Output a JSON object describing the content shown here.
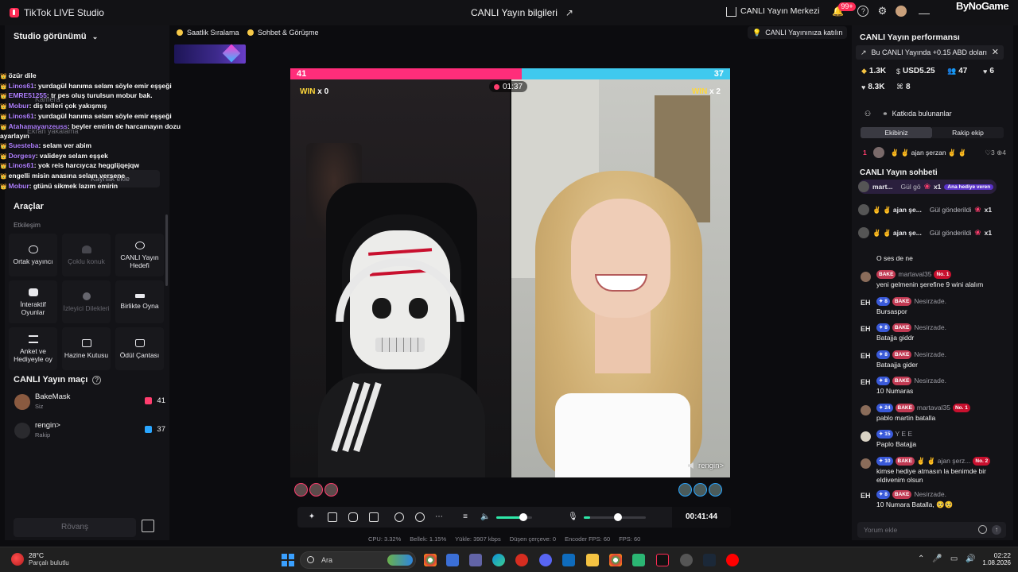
{
  "app": {
    "title": "TikTok LIVE Studio",
    "center_title": "CANLI Yayın bilgileri",
    "live_center": "CANLI Yayın Merkezi",
    "notifications": "99+",
    "watermark": "ByNoGame"
  },
  "left": {
    "studio_view": "Studio görünümü",
    "chat_overlay": [
      {
        "user": "",
        "text": "özür dile"
      },
      {
        "user": "Linos61",
        "text": ": yurdagül hanıma selam söyle emir eşşeği"
      },
      {
        "user": "EMRE51255",
        "text": ": tr pes oluş turulsun mobur bak."
      },
      {
        "user": "Mobur",
        "text": ": diş telleri çok yakışmış"
      },
      {
        "user": "Linos61",
        "text": ": yurdagül hanıma selam söyle emir eşşeği"
      },
      {
        "user": "Atahamayanzeuss",
        "text": ": beyler emirin de harcamayın dozu ayarlayın"
      },
      {
        "user": "Suesteba",
        "text": ": selam ver abim"
      },
      {
        "user": "Dorgesy",
        "text": ": valideye selam eşşek"
      },
      {
        "user": "Linos61",
        "text": ": yok reis harcıycaz hegglijqejqw"
      },
      {
        "user": "",
        "text": "engelli misin anasına selam versene"
      },
      {
        "user": "Mobur",
        "text": ": gtünü sikmek lazım emirin"
      }
    ],
    "ghost": {
      "camera": "Kamera",
      "screen_capture": "Ekran yakalama",
      "add_source": "Kaynak ekle"
    },
    "tools_title": "Araçlar",
    "tools_subtitle": "Etkileşim",
    "tools": [
      {
        "label": "Ortak yayıncı",
        "dim": false
      },
      {
        "label": "Çoklu konuk",
        "dim": true
      },
      {
        "label": "CANLI Yayın Hedefi",
        "dim": false
      },
      {
        "label": "İnteraktif Oyunlar",
        "dim": false
      },
      {
        "label": "İzleyici Dilekleri",
        "dim": true
      },
      {
        "label": "Birlikte Oyna",
        "dim": false
      },
      {
        "label": "Anket ve Hediyeyle oy",
        "dim": false
      },
      {
        "label": "Hazine Kutusu",
        "dim": false
      },
      {
        "label": "Ödül Çantası",
        "dim": false
      }
    ],
    "match_title": "CANLI Yayın maçı",
    "match": [
      {
        "name": "BakeMask",
        "sub": "Siz",
        "score": "41"
      },
      {
        "name": "rengin>",
        "sub": "Rakip",
        "score": "37"
      }
    ],
    "rematch": "Rövanş"
  },
  "top_pills": {
    "ranking": "Saatlik Sıralama",
    "chat_call": "Sohbet & Görüşme",
    "join": "CANLI Yayınınıza katılın"
  },
  "stream": {
    "score_left": "41",
    "score_right": "37",
    "score_ratio": 0.526,
    "timer": "01:37",
    "win_left": "WIN",
    "win_left_count": "x 0",
    "win_right": "WIN",
    "win_right_count": "x 2",
    "opponent_tag": "rengin>"
  },
  "controls": {
    "volume_level": 0.75,
    "mic_level": 0.55,
    "elapsed": "00:41:44"
  },
  "stats": [
    "CPU: 3.32%",
    "Bellek: 1.15%",
    "Yükle: 3907 kbps",
    "Düşen çerçeve: 0",
    "Encoder FPS: 60",
    "FPS: 60"
  ],
  "right": {
    "perf_title": "CANLI Yayın performansı",
    "perf_banner": "Bu CANLI Yayında +0.15 ABD doları",
    "stats_row1": [
      {
        "icon": "diamond-icon",
        "value": "1.3K"
      },
      {
        "icon": "dollar-icon",
        "value": "USD5.25"
      },
      {
        "icon": "users-icon",
        "value": "47"
      },
      {
        "icon": "heart-plus-icon",
        "value": "6"
      }
    ],
    "stats_row2": [
      {
        "icon": "heart-icon",
        "value": "8.3K"
      },
      {
        "icon": "share-icon",
        "value": "8"
      }
    ],
    "contrib_label": "Katkıda bulunanlar",
    "seg_ours": "Ekibiniz",
    "seg_theirs": "Rakip ekip",
    "rank": {
      "pos": "1",
      "name": "✌ ✌ ajan şerzan ✌ ✌",
      "count": "3",
      "count2": "4"
    },
    "chat_title": "CANLI Yayın sohbeti",
    "gifts": [
      {
        "name": "mart...",
        "action": "Gül gö",
        "count": "x1",
        "tag": "Ana hediye veren"
      },
      {
        "name": "✌ ✌ ajan şe...",
        "action": "Gül gönderildi",
        "count": "x1",
        "tag": ""
      },
      {
        "name": "✌ ✌ ajan şe...",
        "action": "Gül gönderildi",
        "count": "x1",
        "tag": ""
      }
    ],
    "messages": [
      {
        "head": {
          "lv": "",
          "fan": "",
          "uname": "",
          "extra": ""
        },
        "body": "O ses de ne",
        "avatar": "none"
      },
      {
        "head": {
          "lv": "",
          "fan": "BAKE",
          "uname": "martaval35",
          "extra": "No. 1"
        },
        "body": "yeni gelmenin şerefine 9 wini alalım",
        "avatar": "photo"
      },
      {
        "head": {
          "lv": "8",
          "fan": "BAKE",
          "uname": "Nesirzade.",
          "extra": ""
        },
        "body": "Bursaspor",
        "avatar": "eh"
      },
      {
        "head": {
          "lv": "8",
          "fan": "BAKE",
          "uname": "Nesirzade.",
          "extra": ""
        },
        "body": "Batajja giddr",
        "avatar": "eh"
      },
      {
        "head": {
          "lv": "8",
          "fan": "BAKE",
          "uname": "Nesirzade.",
          "extra": ""
        },
        "body": "Bataajja gider",
        "avatar": "eh"
      },
      {
        "head": {
          "lv": "8",
          "fan": "BAKE",
          "uname": "Nesirzade.",
          "extra": ""
        },
        "body": "10 Numaras",
        "avatar": "eh"
      },
      {
        "head": {
          "lv": "24",
          "fan": "BAKE",
          "uname": "martaval35",
          "extra": "No. 1"
        },
        "body": "pablo martin batalla",
        "avatar": "photo"
      },
      {
        "head": {
          "lv": "15",
          "fan": "",
          "uname": "Y E E",
          "extra": ""
        },
        "body": "Paplo Batajja",
        "avatar": "light"
      },
      {
        "head": {
          "lv": "10",
          "fan": "BAKE",
          "uname": "✌ ✌ ajan şerz...",
          "extra": "No. 2"
        },
        "body": "kimse hediye atmasın la benimde bir eldivenim olsun",
        "avatar": "photo"
      },
      {
        "head": {
          "lv": "8",
          "fan": "BAKE",
          "uname": "Nesirzade.",
          "extra": ""
        },
        "body": "10 Numara Batalla, 🥺🥺",
        "avatar": "eh"
      }
    ],
    "comment_placeholder": "Yorum ekle"
  },
  "taskbar": {
    "temp": "28°C",
    "weather": "Parçalı bulutlu",
    "search_placeholder": "Ara",
    "time": "02:22",
    "date": "1.08.2026"
  },
  "colors": {
    "accent_red": "#fe2c55",
    "score_red": "#ff2d7a",
    "score_blue": "#3fc9ee",
    "volume_green": "#2ee8a8"
  }
}
